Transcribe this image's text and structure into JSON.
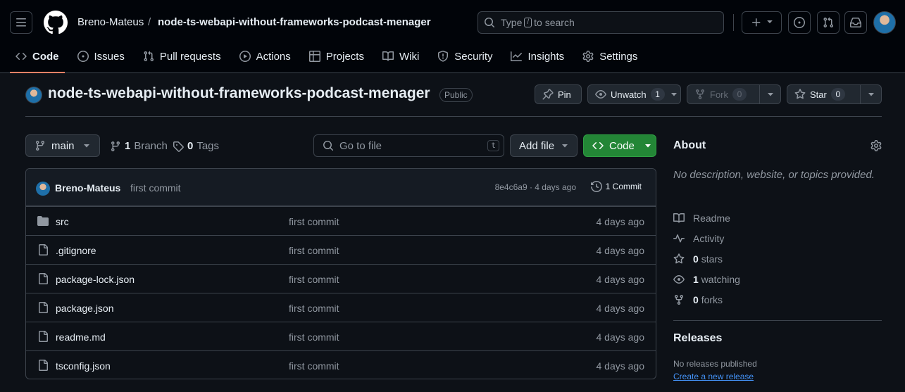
{
  "header": {
    "owner": "Breno-Mateus",
    "separator": "/",
    "repo": "node-ts-webapi-without-frameworks-podcast-menager",
    "search": {
      "prefix": "Type",
      "key": "/",
      "suffix": "to search"
    }
  },
  "tabs": [
    {
      "label": "Code",
      "icon": "code-icon",
      "active": true
    },
    {
      "label": "Issues",
      "icon": "issue-icon"
    },
    {
      "label": "Pull requests",
      "icon": "pull-request-icon"
    },
    {
      "label": "Actions",
      "icon": "play-icon"
    },
    {
      "label": "Projects",
      "icon": "table-icon"
    },
    {
      "label": "Wiki",
      "icon": "book-icon"
    },
    {
      "label": "Security",
      "icon": "shield-icon"
    },
    {
      "label": "Insights",
      "icon": "graph-icon"
    },
    {
      "label": "Settings",
      "icon": "gear-icon"
    }
  ],
  "repo": {
    "name": "node-ts-webapi-without-frameworks-podcast-menager",
    "visibility": "Public",
    "pin_label": "Pin",
    "unwatch_label": "Unwatch",
    "watch_count": "1",
    "fork_label": "Fork",
    "fork_count": "0",
    "star_label": "Star",
    "star_count": "0"
  },
  "toolbar": {
    "branch": "main",
    "branch_count": "1",
    "branch_label": "Branch",
    "tag_count": "0",
    "tag_label": "Tags",
    "goto_placeholder": "Go to file",
    "goto_key": "t",
    "add_file_label": "Add file",
    "code_label": "Code"
  },
  "latest_commit": {
    "author": "Breno-Mateus",
    "message": "first commit",
    "hash_time": "8e4c6a9 · 4 days ago",
    "commits_label": "1 Commit"
  },
  "files": [
    {
      "name": "src",
      "type": "folder",
      "message": "first commit",
      "date": "4 days ago"
    },
    {
      "name": ".gitignore",
      "type": "file",
      "message": "first commit",
      "date": "4 days ago"
    },
    {
      "name": "package-lock.json",
      "type": "file",
      "message": "first commit",
      "date": "4 days ago"
    },
    {
      "name": "package.json",
      "type": "file",
      "message": "first commit",
      "date": "4 days ago"
    },
    {
      "name": "readme.md",
      "type": "file",
      "message": "first commit",
      "date": "4 days ago"
    },
    {
      "name": "tsconfig.json",
      "type": "file",
      "message": "first commit",
      "date": "4 days ago"
    }
  ],
  "about": {
    "title": "About",
    "description": "No description, website, or topics provided.",
    "readme": "Readme",
    "activity": "Activity",
    "stars_count": "0",
    "stars_label": "stars",
    "watching_count": "1",
    "watching_label": "watching",
    "forks_count": "0",
    "forks_label": "forks"
  },
  "releases": {
    "title": "Releases",
    "none": "No releases published",
    "create_link": "Create a new release"
  },
  "colors": {
    "background": "#0d1117",
    "header_bg": "#010409",
    "border": "#3d444d",
    "active_tab_underline": "#f78166",
    "code_button": "#238636",
    "link": "#4493f8"
  }
}
